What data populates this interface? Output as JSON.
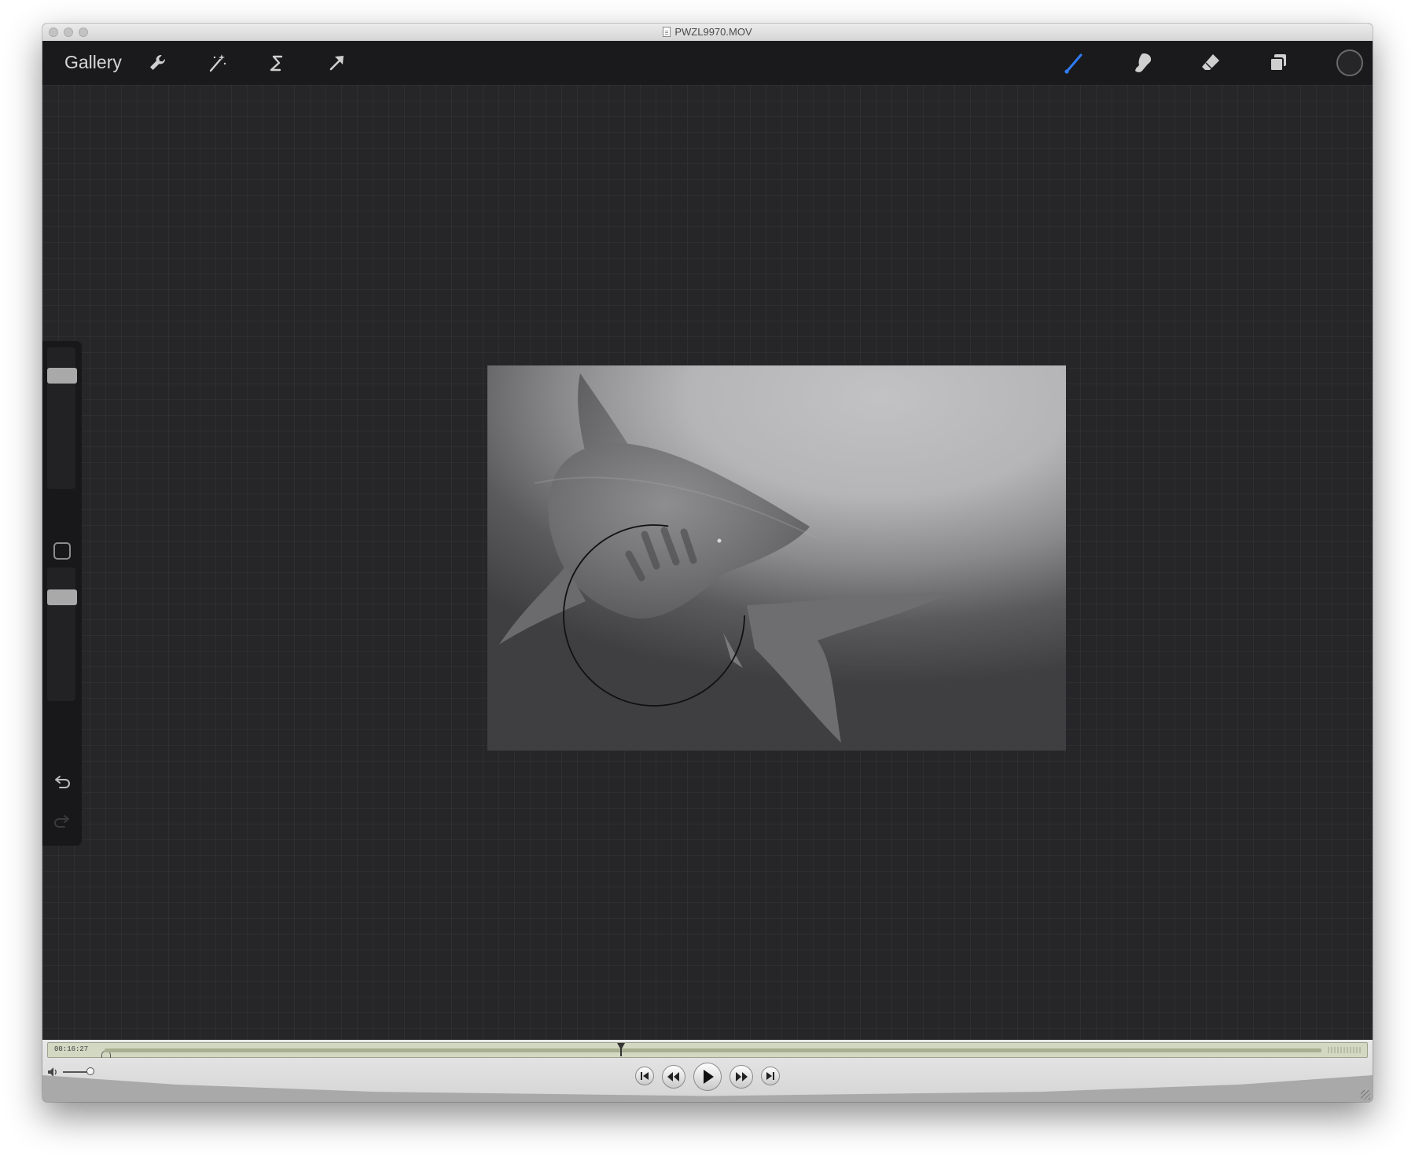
{
  "window": {
    "title": "PWZL9970.MOV"
  },
  "toolbar": {
    "gallery_label": "Gallery",
    "left_tools": [
      "wrench-icon",
      "magic-wand-icon",
      "selection-icon",
      "transform-arrow-icon"
    ],
    "right_tools": [
      "brush-icon",
      "smudge-icon",
      "eraser-icon",
      "layers-icon",
      "color-swatch"
    ],
    "active_tool": "brush",
    "active_color": "#2f7cf6",
    "current_color": "#262629"
  },
  "sidebar": {
    "brush_size": 0.92,
    "opacity": 0.93,
    "icons": [
      "modify-button",
      "undo-icon",
      "redo-icon"
    ]
  },
  "canvas": {
    "artwork": "shark painting, grayscale",
    "cursor": "brush-size-circle"
  },
  "player": {
    "timecode": "00:16:27",
    "position": 0.43,
    "volume": 0.9,
    "buttons": [
      "skip-to-start",
      "rewind",
      "play",
      "fast-forward",
      "skip-to-end"
    ]
  }
}
